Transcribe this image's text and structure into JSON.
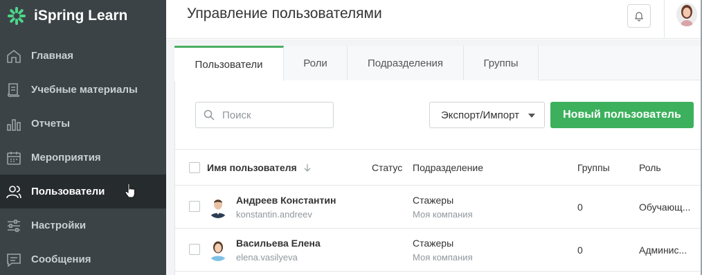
{
  "app": {
    "name": "iSpring Learn"
  },
  "sidebar": {
    "items": [
      {
        "label": "Главная",
        "icon": "home-icon"
      },
      {
        "label": "Учебные материалы",
        "icon": "book-icon"
      },
      {
        "label": "Отчеты",
        "icon": "chart-icon"
      },
      {
        "label": "Мероприятия",
        "icon": "calendar-icon"
      },
      {
        "label": "Пользователи",
        "icon": "users-icon",
        "active": true
      },
      {
        "label": "Настройки",
        "icon": "settings-sliders-icon"
      },
      {
        "label": "Сообщения",
        "icon": "message-icon"
      }
    ]
  },
  "header": {
    "title": "Управление пользователями"
  },
  "tabs": [
    {
      "label": "Пользователи",
      "active": true
    },
    {
      "label": "Роли"
    },
    {
      "label": "Подразделения"
    },
    {
      "label": "Группы"
    }
  ],
  "toolbar": {
    "search_placeholder": "Поиск",
    "export_label": "Экспорт/Импорт",
    "new_user_label": "Новый пользователь"
  },
  "table": {
    "columns": {
      "name": "Имя пользователя",
      "status": "Статус",
      "department": "Подразделение",
      "groups": "Группы",
      "role": "Роль"
    },
    "rows": [
      {
        "name": "Андреев Константин",
        "login": "konstantin.andreev",
        "department": "Стажеры",
        "organization": "Моя компания",
        "groups": "0",
        "role": "Обучающ..."
      },
      {
        "name": "Васильева Елена",
        "login": "elena.vasilyeva",
        "department": "Стажеры",
        "organization": "Моя компания",
        "groups": "0",
        "role": "Админис..."
      }
    ]
  },
  "colors": {
    "sidebar_bg": "#3c4346",
    "sidebar_active_bg": "#262b2e",
    "accent_green": "#3cb05c",
    "logo_green": "#4cd48a"
  }
}
